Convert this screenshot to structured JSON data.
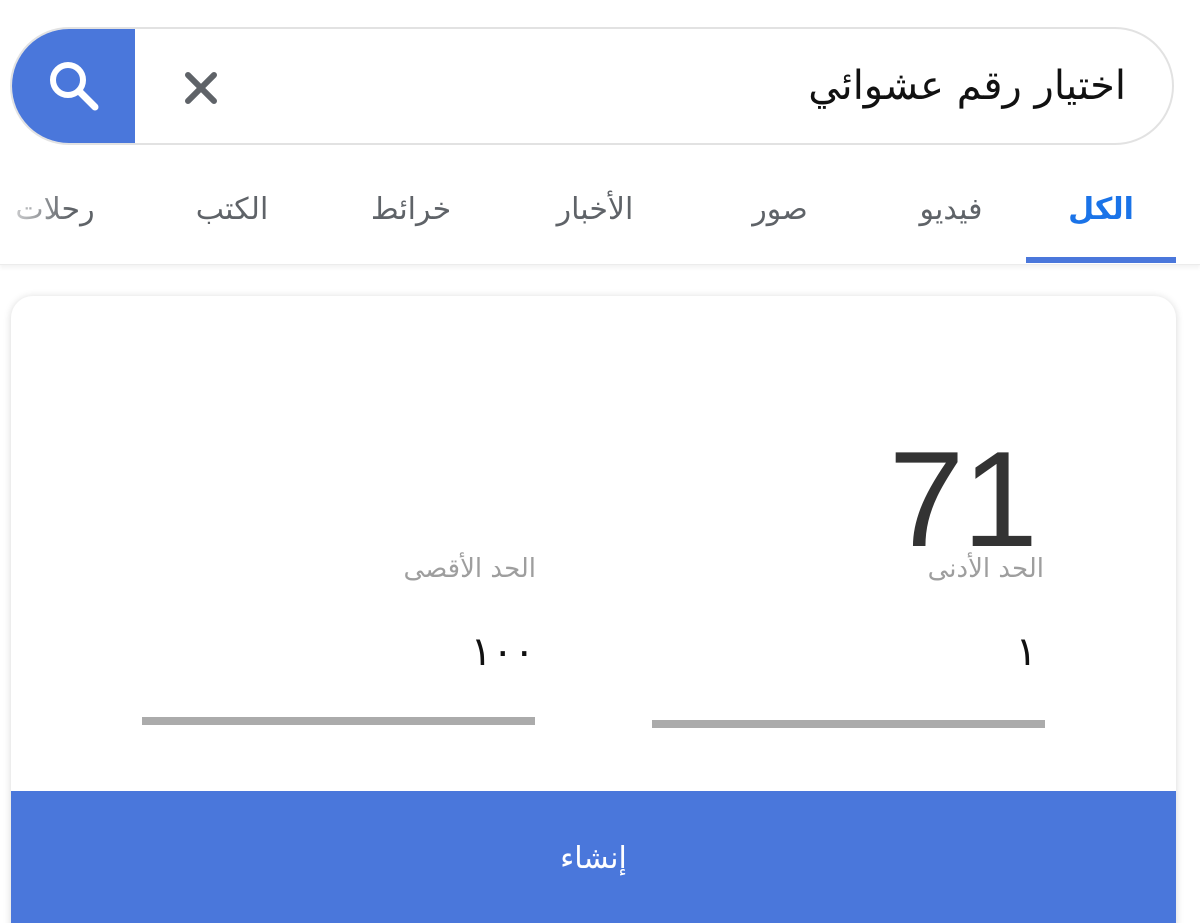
{
  "search": {
    "query": "اختيار رقم عشوائي",
    "search_icon": "search-icon",
    "clear_icon": "close-icon",
    "accent_color": "#4a77db"
  },
  "tabs": [
    {
      "label": "الكل",
      "active": true
    },
    {
      "label": "فيديو",
      "active": false
    },
    {
      "label": "صور",
      "active": false
    },
    {
      "label": "الأخبار",
      "active": false
    },
    {
      "label": "خرائط",
      "active": false
    },
    {
      "label": "الكتب",
      "active": false
    },
    {
      "label": "رحلات",
      "active": false
    }
  ],
  "generator": {
    "result": "71",
    "min_label": "الحد الأدنى",
    "min_value": "١",
    "max_label": "الحد الأقصى",
    "max_value": "١٠٠",
    "button_label": "إنشاء"
  }
}
